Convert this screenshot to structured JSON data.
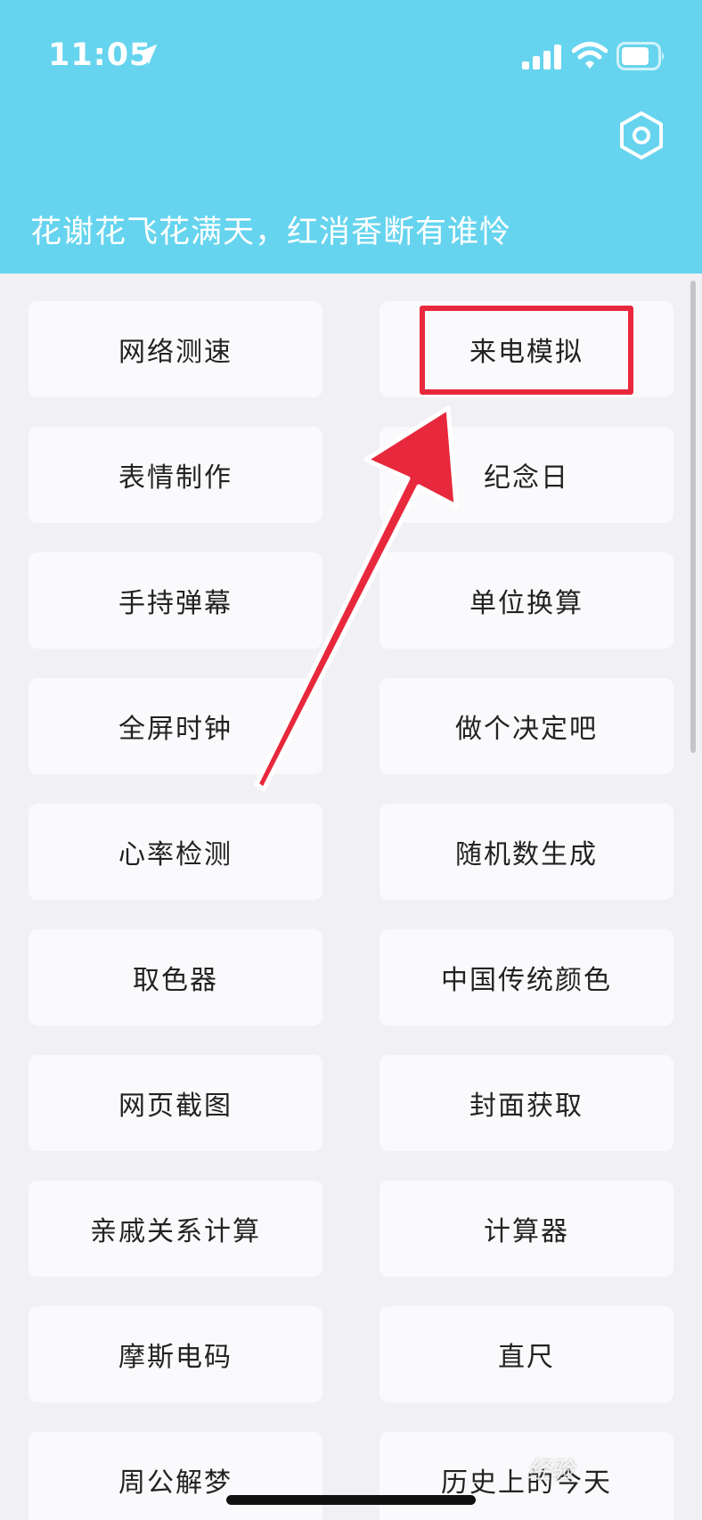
{
  "status_bar": {
    "time": "11:05"
  },
  "header": {
    "slogan": "花谢花飞花满天，红消香断有谁怜"
  },
  "colors": {
    "header_bg": "#66D4EE",
    "page_bg": "#F1F1F5",
    "tile_bg": "#FAFAFC",
    "highlight": "#E8283C"
  },
  "tools": [
    "网络测速",
    "来电模拟",
    "表情制作",
    "纪念日",
    "手持弹幕",
    "单位换算",
    "全屏时钟",
    "做个决定吧",
    "心率检测",
    "随机数生成",
    "取色器",
    "中国传统颜色",
    "网页截图",
    "封面获取",
    "亲戚关系计算",
    "计算器",
    "摩斯电码",
    "直尺",
    "周公解梦",
    "历史上的今天"
  ],
  "icons": [
    "location-arrow-icon",
    "cellular-signal-icon",
    "wifi-icon",
    "battery-icon",
    "settings-hexagon-icon"
  ],
  "watermark": "经验"
}
